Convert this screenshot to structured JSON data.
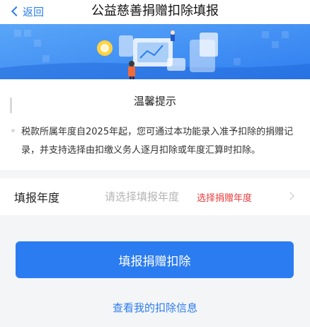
{
  "nav": {
    "back_label": "返回",
    "title": "公益慈善捐赠扣除填报"
  },
  "notice": {
    "title": "温馨提示",
    "body": "税款所属年度自2025年起，您可通过本功能录入准予扣除的捐赠记录，并支持选择由扣缴义务人逐月扣除或年度汇算时扣除。"
  },
  "year_row": {
    "label": "填报年度",
    "placeholder": "请选择填报年度",
    "hint": "选择捐赠年度"
  },
  "actions": {
    "primary_label": "填报捐赠扣除",
    "link_label": "查看我的扣除信息"
  },
  "colors": {
    "accent": "#2b7cf0",
    "warning": "#e83b3b",
    "banner_bg": "#3d8ff2"
  },
  "icons": {
    "back": "chevron-left-icon",
    "row_arrow": "chevron-right-icon"
  }
}
